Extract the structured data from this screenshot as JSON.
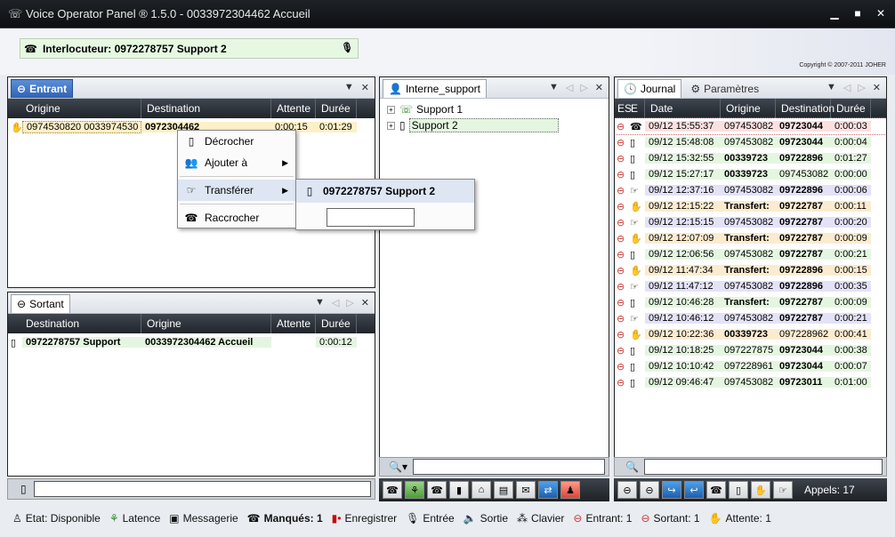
{
  "window": {
    "title": "Voice Operator Panel ® 1.5.0 - 0033972304462 Accueil"
  },
  "interlocutor": {
    "label": "Interlocuteur: 0972278757 Support 2"
  },
  "copyright": "Copyright © 2007-2011 JOHER",
  "entrant": {
    "tab": "Entrant",
    "columns": [
      "Origine",
      "Destination",
      "Attente",
      "Durée"
    ],
    "rows": [
      {
        "origine": "0974530820 0033974530",
        "destination": "0972304462",
        "attente": "0:00:15",
        "duree": "0:01:29"
      }
    ]
  },
  "context_menu": {
    "items": [
      "Décrocher",
      "Ajouter à",
      "Transférer",
      "Raccrocher"
    ],
    "submenu_item": "0972278757 Support 2"
  },
  "sortant": {
    "tab": "Sortant",
    "columns": [
      "Destination",
      "Origine",
      "Attente",
      "Durée"
    ],
    "rows": [
      {
        "destination": "0972278757 Support",
        "origine": "0033972304462 Accueil",
        "attente": "",
        "duree": "0:00:12"
      }
    ]
  },
  "interne": {
    "tab": "Interne_support",
    "tree": [
      "Support 1",
      "Support 2"
    ]
  },
  "journal": {
    "tab": "Journal",
    "tab2": "Paramètres",
    "columns": [
      "ES",
      "E",
      "Date",
      "Origine",
      "Destination",
      "Durée"
    ],
    "rows": [
      {
        "date": "09/12 15:55:37",
        "origine": "097453082",
        "destination": "09723044",
        "duree": "0:00:03",
        "bg": "#fbe0e0",
        "obold": false
      },
      {
        "date": "09/12 15:48:08",
        "origine": "097453082",
        "destination": "09723044",
        "duree": "0:00:04",
        "bg": "#e4f6e0",
        "obold": false
      },
      {
        "date": "09/12 15:32:55",
        "origine": "00339723",
        "destination": "09722896",
        "duree": "0:01:27",
        "bg": "#e4f6e0",
        "obold": true
      },
      {
        "date": "09/12 15:27:17",
        "origine": "00339723",
        "destination": "097453082",
        "duree": "0:00:00",
        "bg": "#e4f6e0",
        "obold": true,
        "dnormal": true
      },
      {
        "date": "09/12 12:37:16",
        "origine": "097453082",
        "destination": "09722896",
        "duree": "0:00:06",
        "bg": "#e4e2f6",
        "obold": false
      },
      {
        "date": "09/12 12:15:22",
        "origine": "Transfert:",
        "destination": "09722787",
        "duree": "0:00:11",
        "bg": "#fbecd0",
        "obold": true
      },
      {
        "date": "09/12 12:15:15",
        "origine": "097453082",
        "destination": "09722787",
        "duree": "0:00:20",
        "bg": "#e4e2f6",
        "obold": false
      },
      {
        "date": "09/12 12:07:09",
        "origine": "Transfert:",
        "destination": "09722787",
        "duree": "0:00:09",
        "bg": "#fbecd0",
        "obold": true
      },
      {
        "date": "09/12 12:06:56",
        "origine": "097453082",
        "destination": "09722787",
        "duree": "0:00:21",
        "bg": "#e4f6e0",
        "obold": false
      },
      {
        "date": "09/12 11:47:34",
        "origine": "Transfert:",
        "destination": "09722896",
        "duree": "0:00:15",
        "bg": "#fbecd0",
        "obold": true
      },
      {
        "date": "09/12 11:47:12",
        "origine": "097453082",
        "destination": "09722896",
        "duree": "0:00:35",
        "bg": "#e4e2f6",
        "obold": false
      },
      {
        "date": "09/12 10:46:28",
        "origine": "Transfert:",
        "destination": "09722787",
        "duree": "0:00:09",
        "bg": "#e4f6e0",
        "obold": true
      },
      {
        "date": "09/12 10:46:12",
        "origine": "097453082",
        "destination": "09722787",
        "duree": "0:00:21",
        "bg": "#e4e2f6",
        "obold": false
      },
      {
        "date": "09/12 10:22:36",
        "origine": "00339723",
        "destination": "097228962",
        "duree": "0:00:41",
        "bg": "#fbecd0",
        "obold": true,
        "dnormal": true
      },
      {
        "date": "09/12 10:18:25",
        "origine": "097227875",
        "destination": "09723044",
        "duree": "0:00:38",
        "bg": "#e4f6e0",
        "obold": false
      },
      {
        "date": "09/12 10:10:42",
        "origine": "097228961",
        "destination": "09723044",
        "duree": "0:00:07",
        "bg": "#e4f6e0",
        "obold": false
      },
      {
        "date": "09/12 09:46:47",
        "origine": "097453082",
        "destination": "09723011",
        "duree": "0:01:00",
        "bg": "#e4f6e0",
        "obold": false
      }
    ],
    "appels": "Appels: 17"
  },
  "status": {
    "etat": "Etat: Disponible",
    "latence": "Latence",
    "messagerie": "Messagerie",
    "manques": "Manqués: 1",
    "enregistrer": "Enregistrer",
    "entree": "Entrée",
    "sortie": "Sortie",
    "clavier": "Clavier",
    "entrant": "Entrant: 1",
    "sortant": "Sortant: 1",
    "attente": "Attente: 1"
  }
}
